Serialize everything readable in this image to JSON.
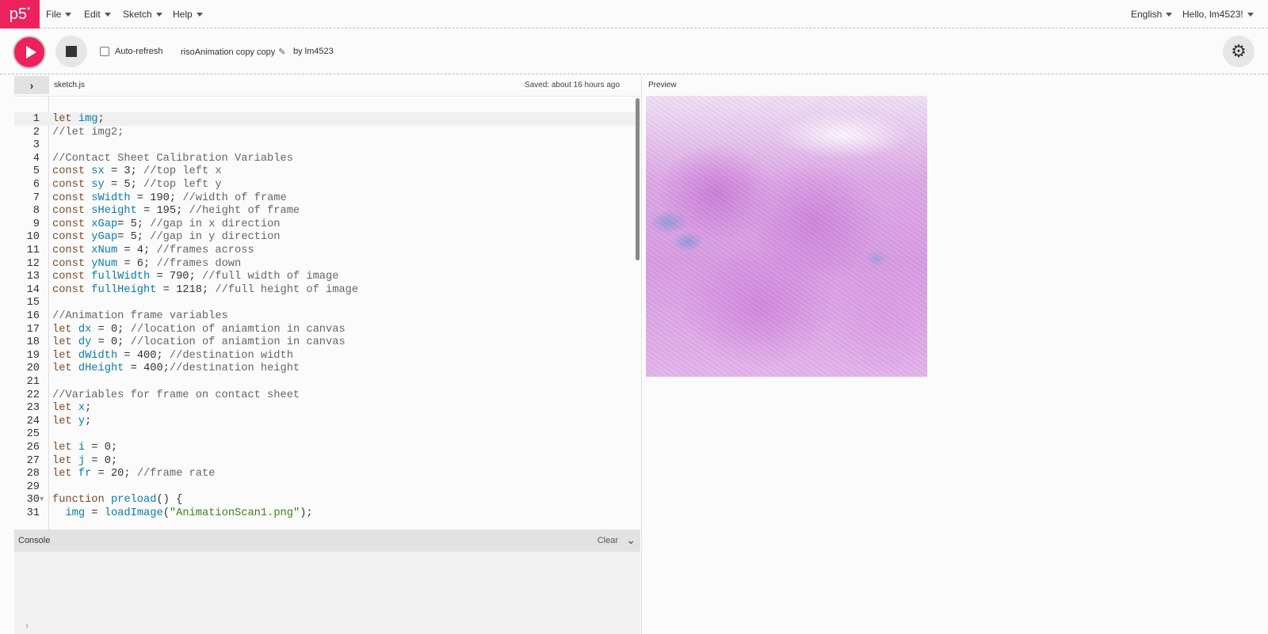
{
  "nav": {
    "logo": "p5",
    "logo_sup": "*",
    "menus": [
      {
        "label": "File"
      },
      {
        "label": "Edit"
      },
      {
        "label": "Sketch"
      },
      {
        "label": "Help"
      }
    ],
    "language": "English",
    "user": "Hello, lm4523!"
  },
  "toolbar": {
    "auto_refresh_label": "Auto-refresh",
    "auto_refresh_checked": false,
    "sketch_name": "risoAnimation copy copy",
    "by": "by lm4523"
  },
  "editor": {
    "filename": "sketch.js",
    "saved_status": "Saved: about 16 hours ago",
    "lines": [
      {
        "n": "1",
        "text": "let img;"
      },
      {
        "n": "2",
        "text": "//let img2;"
      },
      {
        "n": "3",
        "text": ""
      },
      {
        "n": "4",
        "text": "//Contact Sheet Calibration Variables"
      },
      {
        "n": "5",
        "text": "const sx = 3; //top left x"
      },
      {
        "n": "6",
        "text": "const sy = 5; //top left y"
      },
      {
        "n": "7",
        "text": "const sWidth = 190; //width of frame"
      },
      {
        "n": "8",
        "text": "const sHeight = 195; //height of frame"
      },
      {
        "n": "9",
        "text": "const xGap= 5; //gap in x direction"
      },
      {
        "n": "10",
        "text": "const yGap= 5; //gap in y direction"
      },
      {
        "n": "11",
        "text": "const xNum = 4; //frames across"
      },
      {
        "n": "12",
        "text": "const yNum = 6; //frames down"
      },
      {
        "n": "13",
        "text": "const fullWidth = 790; //full width of image"
      },
      {
        "n": "14",
        "text": "const fullHeight = 1218; //full height of image"
      },
      {
        "n": "15",
        "text": ""
      },
      {
        "n": "16",
        "text": "//Animation frame variables"
      },
      {
        "n": "17",
        "text": "let dx = 0; //location of aniamtion in canvas"
      },
      {
        "n": "18",
        "text": "let dy = 0; //location of aniamtion in canvas"
      },
      {
        "n": "19",
        "text": "let dWidth = 400; //destination width"
      },
      {
        "n": "20",
        "text": "let dHeight = 400;//destination height"
      },
      {
        "n": "21",
        "text": ""
      },
      {
        "n": "22",
        "text": "//Variables for frame on contact sheet"
      },
      {
        "n": "23",
        "text": "let x;"
      },
      {
        "n": "24",
        "text": "let y;"
      },
      {
        "n": "25",
        "text": ""
      },
      {
        "n": "26",
        "text": "let i = 0;"
      },
      {
        "n": "27",
        "text": "let j = 0;"
      },
      {
        "n": "28",
        "text": "let fr = 20; //frame rate"
      },
      {
        "n": "29",
        "text": ""
      },
      {
        "n": "30",
        "text": "function preload() {"
      },
      {
        "n": "31",
        "text": "  img = loadImage(\"AnimationScan1.png\");"
      }
    ]
  },
  "console": {
    "label": "Console",
    "clear": "Clear"
  },
  "preview": {
    "label": "Preview"
  },
  "colors": {
    "accent": "#ed225d",
    "keyword": "#7a4e2a",
    "variable": "#0b7ca9",
    "comment": "#666666",
    "string": "#42801a"
  },
  "icons": {
    "play": "play-icon",
    "stop": "stop-icon",
    "settings": "gear-icon",
    "pencil": "pencil-icon",
    "toggle": "chevron-right-icon",
    "console_collapse": "chevron-down-icon"
  }
}
